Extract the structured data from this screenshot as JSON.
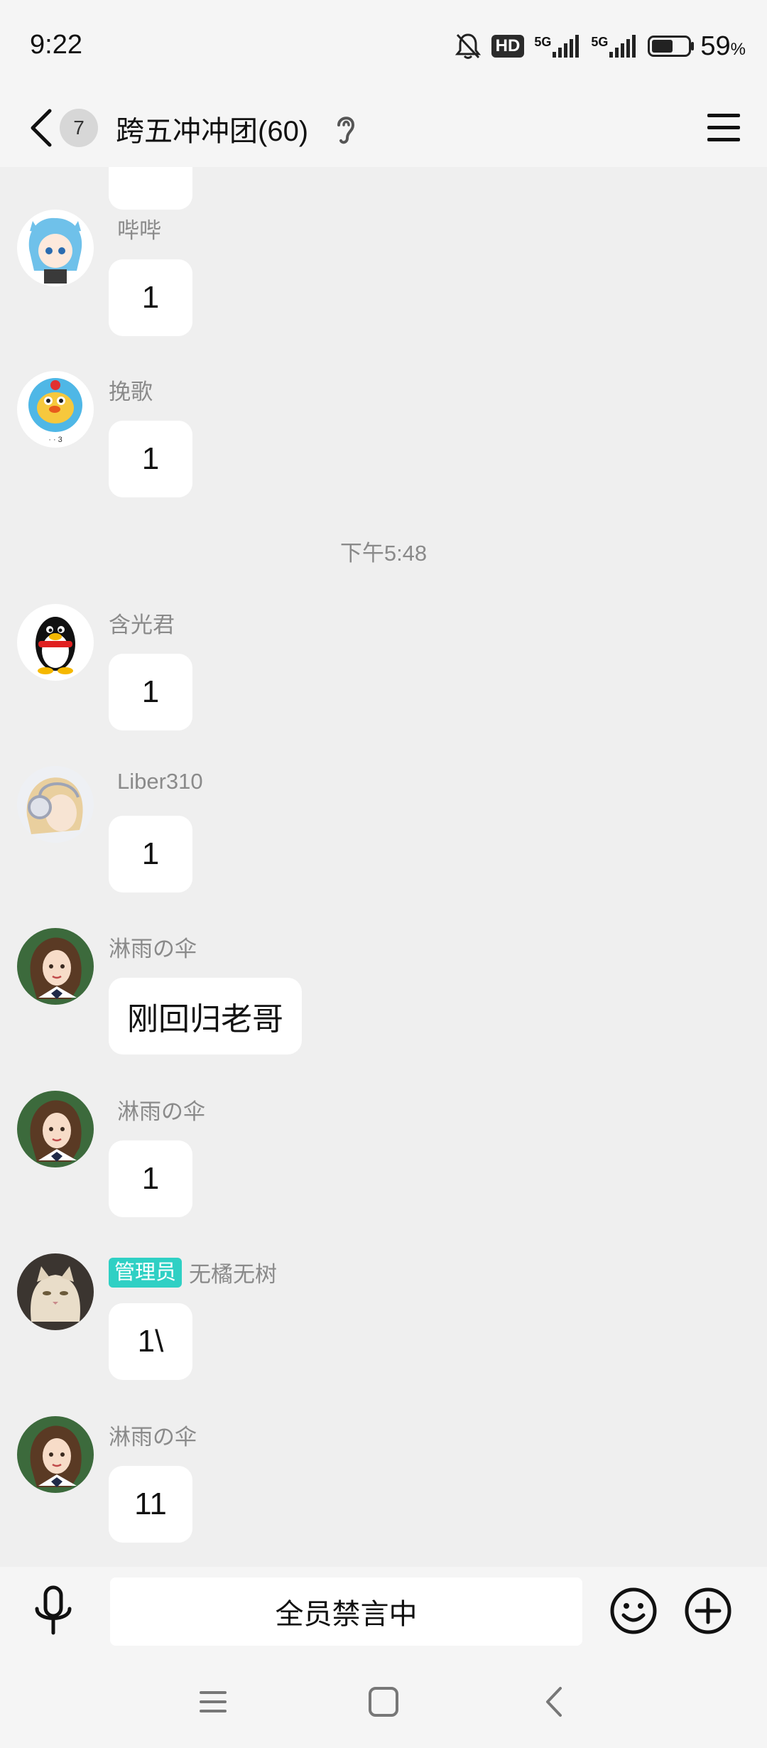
{
  "status_bar": {
    "time": "9:22",
    "hd": "HD",
    "net1": "5G",
    "net2": "5G",
    "battery_pct": "59",
    "battery_unit": "%",
    "battery_level": 0.59
  },
  "header": {
    "unread_count": "7",
    "group_title": "跨五冲冲团(60)"
  },
  "messages": [
    {
      "sender": "哔哔",
      "text": "1",
      "avatar": "anime-blue-hair-avatar"
    },
    {
      "sender": "挽歌",
      "text": "1",
      "avatar": "yellow-duck-avatar"
    },
    {
      "sender": "含光君",
      "text": "1",
      "avatar": "qq-penguin-avatar"
    },
    {
      "sender": "Liber310",
      "text": "1",
      "avatar": "anime-headphones-avatar"
    },
    {
      "sender": "淋雨の伞",
      "text": "刚回归老哥",
      "avatar": "girl-portrait-avatar"
    },
    {
      "sender": "淋雨の伞",
      "text": "1",
      "avatar": "girl-portrait-avatar"
    },
    {
      "sender": "无橘无树",
      "role": "管理员",
      "text": "1\\",
      "avatar": "cat-avatar"
    },
    {
      "sender": "淋雨の伞",
      "text": "11",
      "avatar": "girl-portrait-avatar"
    }
  ],
  "time_divider": "下午5:48",
  "input_bar": {
    "mute_text": "全员禁言中"
  },
  "colors": {
    "admin_tag": "#2fd0c4",
    "background": "#efefef",
    "bubble": "#ffffff"
  }
}
